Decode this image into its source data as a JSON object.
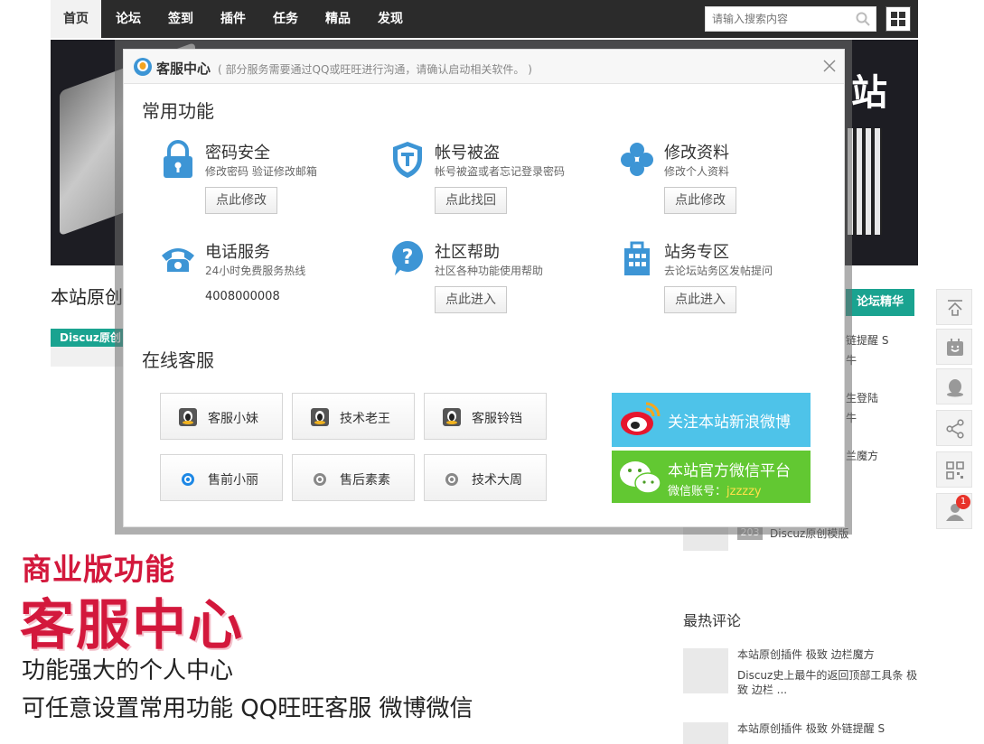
{
  "nav": {
    "items": [
      "首页",
      "论坛",
      "签到",
      "插件",
      "任务",
      "精品",
      "发现"
    ],
    "search_placeholder": "请输入搜索内容"
  },
  "background": {
    "banner_word": "站",
    "post_title": "本站原创",
    "category_tag": "Discuz原创插",
    "side_tab": "论坛精华",
    "side_lines": [
      "链提醒 S",
      "牛",
      "生登陆",
      "牛",
      "兰魔方"
    ],
    "counter": "203",
    "counter_label": "Discuz原创模版",
    "hot_title": "最热评论",
    "hot_items": [
      {
        "title": "本站原创插件 极致 边栏魔方",
        "desc": "Discuz史上最牛的返回顶部工具条 极致 边栏 ..."
      },
      {
        "title": "本站原创插件 极致 外链提醒 S",
        "desc": ""
      }
    ]
  },
  "right_toolbar": {
    "badge_count": "1"
  },
  "promo": {
    "line1": "商业版功能",
    "line2": "客服中心",
    "line3": "功能强大的个人中心",
    "line4": "可任意设置常用功能 QQ旺旺客服 微博微信"
  },
  "modal": {
    "title": "客服中心",
    "subtitle": "( 部分服务需要通过QQ或旺旺进行沟通，请确认启动相关软件。 )",
    "common_title": "常用功能",
    "features": [
      {
        "name": "密码安全",
        "desc": "修改密码 验证修改邮箱",
        "button": "点此修改"
      },
      {
        "name": "帐号被盗",
        "desc": "帐号被盗或者忘记登录密码",
        "button": "点此找回"
      },
      {
        "name": "修改资料",
        "desc": "修改个人资料",
        "button": "点此修改"
      },
      {
        "name": "电话服务",
        "desc": "24小时免费服务热线",
        "phone": "4008000008"
      },
      {
        "name": "社区帮助",
        "desc": "社区各种功能使用帮助",
        "button": "点此进入"
      },
      {
        "name": "站务专区",
        "desc": "去论坛站务区发帖提问",
        "button": "点此进入"
      }
    ],
    "online_title": "在线客服",
    "agents": [
      "客服小妹",
      "技术老王",
      "客服铃铛",
      "售前小丽",
      "售后素素",
      "技术大周"
    ],
    "weibo_text": "关注本站新浪微博",
    "wechat_text": "本站官方微信平台",
    "wechat_account_label": "微信账号：",
    "wechat_account": "jzzzzy"
  },
  "colors": {
    "nav_bg": "#2b2b2b",
    "teal": "#1aa390",
    "icon_blue": "#3d95d5",
    "promo_red": "#d3183c",
    "weibo_bg": "#4ec3e9",
    "wechat_bg": "#62c832"
  }
}
